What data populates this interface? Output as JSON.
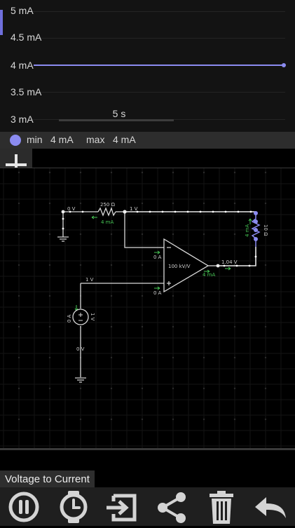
{
  "graph": {
    "y_labels": [
      "5 mA",
      "4.5 mA",
      "4 mA",
      "3.5 mA",
      "3 mA"
    ],
    "timescale": "5 s",
    "trace_color": "#8b8bf0",
    "accent_color": "#6f6fdc"
  },
  "stats": {
    "min_label": "min",
    "min_value": "4 mA",
    "max_label": "max",
    "max_value": "4 mA"
  },
  "circuit": {
    "name": "Voltage to Current",
    "labels": {
      "v_top_left": "0 V",
      "resistor_value": "250 Ω",
      "resistor_current": "4 mA",
      "v_node": "1 V",
      "load_current": "4 mA",
      "load_resistor": "10 Ω",
      "opamp_gain": "100 kV/V",
      "minus_input_current": "0 A",
      "plus_input_current": "0 A",
      "output_voltage": "1.04 V",
      "output_current": "4 mA",
      "source_node_voltage": "1 V",
      "source_current": "0 A",
      "source_voltage": "1 V",
      "v_bottom": "0 V"
    }
  },
  "toolbar": {
    "icons": [
      "pause-icon",
      "clock-icon",
      "export-icon",
      "share-icon",
      "trash-icon",
      "undo-icon"
    ]
  }
}
